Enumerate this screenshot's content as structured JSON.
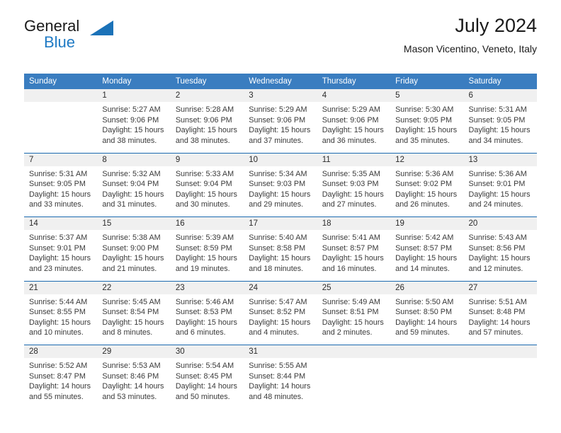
{
  "brand": {
    "name_part1": "General",
    "name_part2": "Blue",
    "accent_color": "#1b72b8"
  },
  "header": {
    "title": "July 2024",
    "subtitle": "Mason Vicentino, Veneto, Italy"
  },
  "calendar": {
    "header_bg": "#3a7dc0",
    "daynum_bg": "#f0f0f0",
    "separator_color": "#1b6ab0",
    "weekday_headers": [
      "Sunday",
      "Monday",
      "Tuesday",
      "Wednesday",
      "Thursday",
      "Friday",
      "Saturday"
    ],
    "weeks": [
      [
        {
          "day": "",
          "sunrise": "",
          "sunset": "",
          "daylight1": "",
          "daylight2": ""
        },
        {
          "day": "1",
          "sunrise": "Sunrise: 5:27 AM",
          "sunset": "Sunset: 9:06 PM",
          "daylight1": "Daylight: 15 hours",
          "daylight2": "and 38 minutes."
        },
        {
          "day": "2",
          "sunrise": "Sunrise: 5:28 AM",
          "sunset": "Sunset: 9:06 PM",
          "daylight1": "Daylight: 15 hours",
          "daylight2": "and 38 minutes."
        },
        {
          "day": "3",
          "sunrise": "Sunrise: 5:29 AM",
          "sunset": "Sunset: 9:06 PM",
          "daylight1": "Daylight: 15 hours",
          "daylight2": "and 37 minutes."
        },
        {
          "day": "4",
          "sunrise": "Sunrise: 5:29 AM",
          "sunset": "Sunset: 9:06 PM",
          "daylight1": "Daylight: 15 hours",
          "daylight2": "and 36 minutes."
        },
        {
          "day": "5",
          "sunrise": "Sunrise: 5:30 AM",
          "sunset": "Sunset: 9:05 PM",
          "daylight1": "Daylight: 15 hours",
          "daylight2": "and 35 minutes."
        },
        {
          "day": "6",
          "sunrise": "Sunrise: 5:31 AM",
          "sunset": "Sunset: 9:05 PM",
          "daylight1": "Daylight: 15 hours",
          "daylight2": "and 34 minutes."
        }
      ],
      [
        {
          "day": "7",
          "sunrise": "Sunrise: 5:31 AM",
          "sunset": "Sunset: 9:05 PM",
          "daylight1": "Daylight: 15 hours",
          "daylight2": "and 33 minutes."
        },
        {
          "day": "8",
          "sunrise": "Sunrise: 5:32 AM",
          "sunset": "Sunset: 9:04 PM",
          "daylight1": "Daylight: 15 hours",
          "daylight2": "and 31 minutes."
        },
        {
          "day": "9",
          "sunrise": "Sunrise: 5:33 AM",
          "sunset": "Sunset: 9:04 PM",
          "daylight1": "Daylight: 15 hours",
          "daylight2": "and 30 minutes."
        },
        {
          "day": "10",
          "sunrise": "Sunrise: 5:34 AM",
          "sunset": "Sunset: 9:03 PM",
          "daylight1": "Daylight: 15 hours",
          "daylight2": "and 29 minutes."
        },
        {
          "day": "11",
          "sunrise": "Sunrise: 5:35 AM",
          "sunset": "Sunset: 9:03 PM",
          "daylight1": "Daylight: 15 hours",
          "daylight2": "and 27 minutes."
        },
        {
          "day": "12",
          "sunrise": "Sunrise: 5:36 AM",
          "sunset": "Sunset: 9:02 PM",
          "daylight1": "Daylight: 15 hours",
          "daylight2": "and 26 minutes."
        },
        {
          "day": "13",
          "sunrise": "Sunrise: 5:36 AM",
          "sunset": "Sunset: 9:01 PM",
          "daylight1": "Daylight: 15 hours",
          "daylight2": "and 24 minutes."
        }
      ],
      [
        {
          "day": "14",
          "sunrise": "Sunrise: 5:37 AM",
          "sunset": "Sunset: 9:01 PM",
          "daylight1": "Daylight: 15 hours",
          "daylight2": "and 23 minutes."
        },
        {
          "day": "15",
          "sunrise": "Sunrise: 5:38 AM",
          "sunset": "Sunset: 9:00 PM",
          "daylight1": "Daylight: 15 hours",
          "daylight2": "and 21 minutes."
        },
        {
          "day": "16",
          "sunrise": "Sunrise: 5:39 AM",
          "sunset": "Sunset: 8:59 PM",
          "daylight1": "Daylight: 15 hours",
          "daylight2": "and 19 minutes."
        },
        {
          "day": "17",
          "sunrise": "Sunrise: 5:40 AM",
          "sunset": "Sunset: 8:58 PM",
          "daylight1": "Daylight: 15 hours",
          "daylight2": "and 18 minutes."
        },
        {
          "day": "18",
          "sunrise": "Sunrise: 5:41 AM",
          "sunset": "Sunset: 8:57 PM",
          "daylight1": "Daylight: 15 hours",
          "daylight2": "and 16 minutes."
        },
        {
          "day": "19",
          "sunrise": "Sunrise: 5:42 AM",
          "sunset": "Sunset: 8:57 PM",
          "daylight1": "Daylight: 15 hours",
          "daylight2": "and 14 minutes."
        },
        {
          "day": "20",
          "sunrise": "Sunrise: 5:43 AM",
          "sunset": "Sunset: 8:56 PM",
          "daylight1": "Daylight: 15 hours",
          "daylight2": "and 12 minutes."
        }
      ],
      [
        {
          "day": "21",
          "sunrise": "Sunrise: 5:44 AM",
          "sunset": "Sunset: 8:55 PM",
          "daylight1": "Daylight: 15 hours",
          "daylight2": "and 10 minutes."
        },
        {
          "day": "22",
          "sunrise": "Sunrise: 5:45 AM",
          "sunset": "Sunset: 8:54 PM",
          "daylight1": "Daylight: 15 hours",
          "daylight2": "and 8 minutes."
        },
        {
          "day": "23",
          "sunrise": "Sunrise: 5:46 AM",
          "sunset": "Sunset: 8:53 PM",
          "daylight1": "Daylight: 15 hours",
          "daylight2": "and 6 minutes."
        },
        {
          "day": "24",
          "sunrise": "Sunrise: 5:47 AM",
          "sunset": "Sunset: 8:52 PM",
          "daylight1": "Daylight: 15 hours",
          "daylight2": "and 4 minutes."
        },
        {
          "day": "25",
          "sunrise": "Sunrise: 5:49 AM",
          "sunset": "Sunset: 8:51 PM",
          "daylight1": "Daylight: 15 hours",
          "daylight2": "and 2 minutes."
        },
        {
          "day": "26",
          "sunrise": "Sunrise: 5:50 AM",
          "sunset": "Sunset: 8:50 PM",
          "daylight1": "Daylight: 14 hours",
          "daylight2": "and 59 minutes."
        },
        {
          "day": "27",
          "sunrise": "Sunrise: 5:51 AM",
          "sunset": "Sunset: 8:48 PM",
          "daylight1": "Daylight: 14 hours",
          "daylight2": "and 57 minutes."
        }
      ],
      [
        {
          "day": "28",
          "sunrise": "Sunrise: 5:52 AM",
          "sunset": "Sunset: 8:47 PM",
          "daylight1": "Daylight: 14 hours",
          "daylight2": "and 55 minutes."
        },
        {
          "day": "29",
          "sunrise": "Sunrise: 5:53 AM",
          "sunset": "Sunset: 8:46 PM",
          "daylight1": "Daylight: 14 hours",
          "daylight2": "and 53 minutes."
        },
        {
          "day": "30",
          "sunrise": "Sunrise: 5:54 AM",
          "sunset": "Sunset: 8:45 PM",
          "daylight1": "Daylight: 14 hours",
          "daylight2": "and 50 minutes."
        },
        {
          "day": "31",
          "sunrise": "Sunrise: 5:55 AM",
          "sunset": "Sunset: 8:44 PM",
          "daylight1": "Daylight: 14 hours",
          "daylight2": "and 48 minutes."
        },
        {
          "day": "",
          "sunrise": "",
          "sunset": "",
          "daylight1": "",
          "daylight2": ""
        },
        {
          "day": "",
          "sunrise": "",
          "sunset": "",
          "daylight1": "",
          "daylight2": ""
        },
        {
          "day": "",
          "sunrise": "",
          "sunset": "",
          "daylight1": "",
          "daylight2": ""
        }
      ]
    ]
  }
}
